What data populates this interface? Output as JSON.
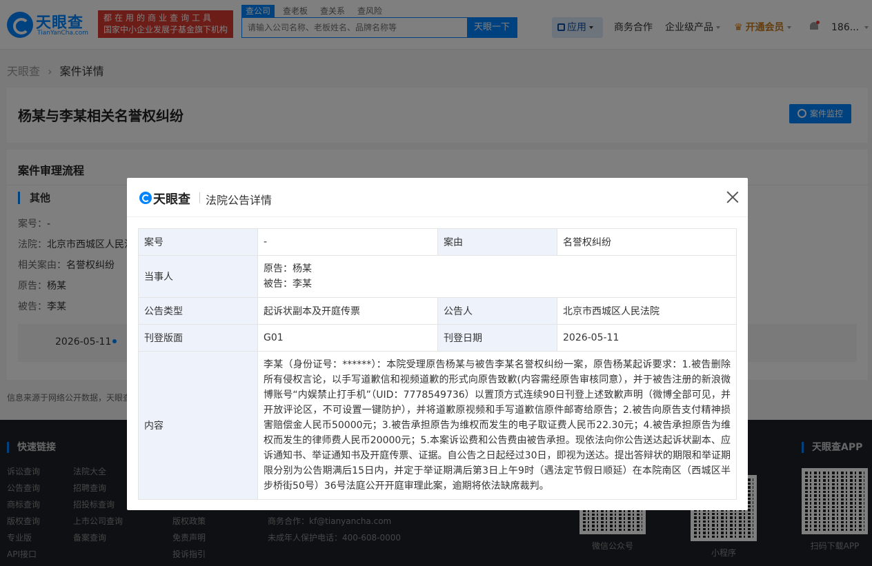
{
  "header": {
    "logo_name": "天眼查",
    "logo_url": "TianYanCha.com",
    "slogan_line1": "都在用的商业查询工具",
    "slogan_line2": "国家中小企业发展子基金旗下机构",
    "search_tabs": [
      "查公司",
      "查老板",
      "查关系",
      "查风险"
    ],
    "search_placeholder": "请输入公司名称、老板姓名、品牌名称等",
    "search_button": "天眼一下",
    "nav_app": "应用",
    "nav_business": "商务合作",
    "nav_enterprise": "企业级产品",
    "nav_vip": "开通会员",
    "user": "186..."
  },
  "breadcrumb": {
    "home": "天眼查",
    "current": "案件详情"
  },
  "case": {
    "title": "杨某与李某相关名誉权纠纷",
    "monitor_button": "案件监控",
    "process_title": "案件审理流程",
    "sub_title": "其他",
    "fields": [
      {
        "label": "案号：",
        "value": "-"
      },
      {
        "label": "法院：",
        "value": "北京市西城区人民法"
      },
      {
        "label": "相关案由：",
        "value": "名誉权纠纷"
      },
      {
        "label": "原告：",
        "value": "杨某"
      },
      {
        "label": "被告：",
        "value": "李某"
      }
    ],
    "timeline_date": "2026-05-11"
  },
  "source_note": "信息来源于网络公开数据，天眼查",
  "footer": {
    "quick_links_title": "快速链接",
    "col1": [
      "诉讼查询",
      "公告查询",
      "商标查询",
      "版权查询",
      "专业版",
      "API接口"
    ],
    "col2": [
      "法院大全",
      "招聘查询",
      "招投标查询",
      "上市公司查询",
      "备案查询"
    ],
    "col3": [
      "版权政策",
      "免责声明",
      "投诉指引"
    ],
    "contact_business": "商务合作：kf@tianyancha.com",
    "contact_minor": "未成年人保护电话：400-608-0000",
    "wechat_caption": "微信公众号",
    "mini_caption": "小程序",
    "app_title": "天眼查APP",
    "app_caption": "扫码下载APP"
  },
  "modal": {
    "logo_name": "天眼查",
    "title": "法院公告详情",
    "rows": {
      "case_no_label": "案号",
      "case_no": "-",
      "cause_label": "案由",
      "cause": "名誉权纠纷",
      "party_label": "当事人",
      "plaintiff": "原告：杨某",
      "defendant": "被告：李某",
      "type_label": "公告类型",
      "type": "起诉状副本及开庭传票",
      "announcer_label": "公告人",
      "announcer": "北京市西城区人民法院",
      "page_label": "刊登版面",
      "page": "G01",
      "date_label": "刊登日期",
      "date": "2026-05-11",
      "content_label": "内容",
      "content": "李某（身份证号：******）：本院受理原告杨某与被告李某名誉权纠纷一案，原告杨某起诉要求：1.被告删除所有侵权言论，以手写道歉信和视频道歉的形式向原告致歉(内容需经原告审核同意），并于被告注册的新浪微博账号“内娱禁止打手机”（UID：7778549736）以置顶方式连续90日刊登上述致歉声明（微博全部可见，并开放评论区，不可设置一键防护），并将道歉原视频和手写道歉信原件邮寄给原告；2.被告向原告支付精神损害赔偿金人民币50000元；3.被告承担原告为维权而发生的电子取证费人民币22.30元；4.被告承担原告为维权而发生的律师费人民币20000元；5.本案诉讼费和公告费由被告承担。现依法向你公告送达起诉状副本、应诉通知书、举证通知书及开庭传票、证据。自公告之日起经过30日，即视为送达。提出答辩状的期限和举证期限分别为公告期满后15日内，并定于举证期满后第3日上午9时（遇法定节假日顺延）在本院南区（西城区半步桥街50号）36号法庭公开开庭审理此案，逾期将依法缺席裁判。"
    }
  }
}
